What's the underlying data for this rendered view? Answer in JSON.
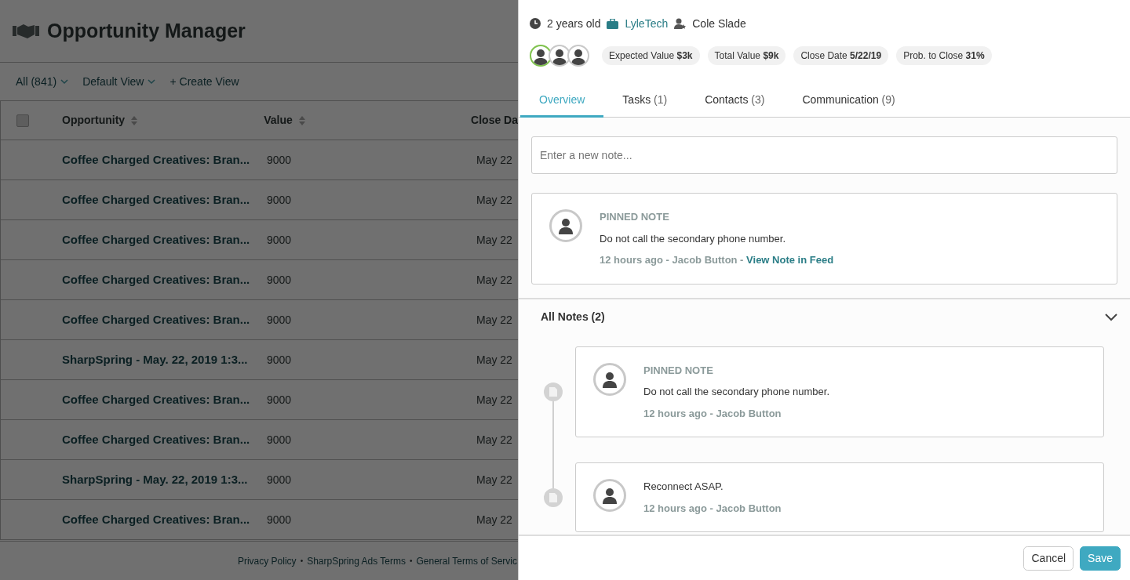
{
  "app": {
    "title": "Opportunity Manager"
  },
  "views": [
    {
      "label": "All (841)",
      "dropdown": true
    },
    {
      "label": "Default View",
      "dropdown": true
    },
    {
      "label": "+ Create View",
      "dropdown": false
    }
  ],
  "table": {
    "select_all": {
      "checked": false
    },
    "columns": [
      {
        "label": "Opportunity",
        "sortable": true
      },
      {
        "label": "Value",
        "sortable": true
      },
      {
        "label": "Close Da",
        "sortable": false
      }
    ],
    "rows": [
      {
        "opportunity": "Coffee Charged Creatives: Bran...",
        "value": "9000",
        "close": "May 22"
      },
      {
        "opportunity": "Coffee Charged Creatives: Bran...",
        "value": "9000",
        "close": "May 22"
      },
      {
        "opportunity": "Coffee Charged Creatives: Bran...",
        "value": "9000",
        "close": "May 22"
      },
      {
        "opportunity": "Coffee Charged Creatives: Bran...",
        "value": "9000",
        "close": "May 22"
      },
      {
        "opportunity": "Coffee Charged Creatives: Bran...",
        "value": "9000",
        "close": "May 22"
      },
      {
        "opportunity": "SharpSpring - May. 22, 2019 1:3...",
        "value": "9000",
        "close": "May 22"
      },
      {
        "opportunity": "Coffee Charged Creatives: Bran...",
        "value": "9000",
        "close": "May 22"
      },
      {
        "opportunity": "Coffee Charged Creatives: Bran...",
        "value": "9000",
        "close": "May 22"
      },
      {
        "opportunity": "SharpSpring - May. 22, 2019 1:3...",
        "value": "9000",
        "close": "May 22"
      },
      {
        "opportunity": "Coffee Charged Creatives: Bran...",
        "value": "9000",
        "close": "May 22"
      }
    ]
  },
  "footer": {
    "separator": "•",
    "links": [
      "Privacy Policy",
      "SharpSpring Ads Terms",
      "General Terms of Servic"
    ]
  },
  "panel": {
    "meta": {
      "age": "2 years old",
      "company": "LyleTech",
      "owner": "Cole Slade"
    },
    "avatars": [
      {
        "selected": true
      },
      {
        "selected": false
      },
      {
        "selected": false
      }
    ],
    "stats": [
      {
        "label": "Expected Value",
        "value": "$3k"
      },
      {
        "label": "Total Value",
        "value": "$9k"
      },
      {
        "label": "Close Date",
        "value": "5/22/19"
      },
      {
        "label": "Prob. to Close",
        "value": "31%"
      }
    ],
    "tabs": [
      {
        "label": "Overview",
        "selected": true
      },
      {
        "label": "Tasks",
        "count": "(1)",
        "selected": false
      },
      {
        "label": "Contacts",
        "count": "(3)",
        "selected": false
      },
      {
        "label": "Communication",
        "count": "(9)",
        "selected": false
      }
    ],
    "note_placeholder": "Enter a new note...",
    "pinned": {
      "heading": "PINNED NOTE",
      "text": "Do not call the secondary phone number.",
      "byline": "12 hours ago - Jacob Button -",
      "link": "View Note in Feed"
    },
    "all_notes": {
      "title": "All Notes (2)",
      "expanded": true,
      "notes": [
        {
          "heading": "PINNED NOTE",
          "text": "Do not call the secondary phone number.",
          "byline": "12 hours ago - Jacob Button"
        },
        {
          "text": "Reconnect ASAP.",
          "byline": "12 hours ago - Jacob Button"
        }
      ]
    },
    "buttons": [
      {
        "label": "Cancel",
        "kind": "secondary"
      },
      {
        "label": "Save",
        "kind": "primary"
      }
    ]
  }
}
